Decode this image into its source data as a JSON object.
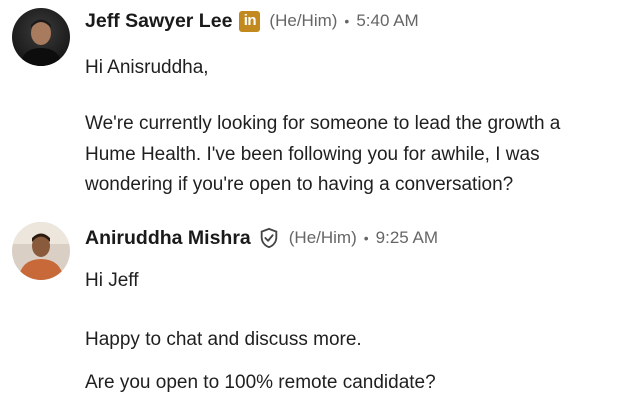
{
  "messages": [
    {
      "sender": "Jeff Sawyer Lee",
      "badge_icon": "linkedin-premium-icon",
      "badge_text": "in",
      "pronouns": "(He/Him)",
      "separator": "•",
      "time": "5:40 AM",
      "lines": [
        "Hi Anisruddha,",
        "We're currently looking for someone to lead the growth a",
        "Hume Health. I've been following you for awhile, I was",
        "wondering if you're open to having a conversation?"
      ]
    },
    {
      "sender": "Aniruddha Mishra",
      "badge_icon": "verified-shield-icon",
      "pronouns": "(He/Him)",
      "separator": "•",
      "time": "9:25 AM",
      "lines": [
        "Hi Jeff",
        "Happy to chat and discuss more.",
        "Are you open to 100% remote candidate?"
      ]
    }
  ],
  "colors": {
    "premium_badge": "#c28a1e",
    "meta_text": "#666666",
    "body_text": "#1f1f1f"
  }
}
